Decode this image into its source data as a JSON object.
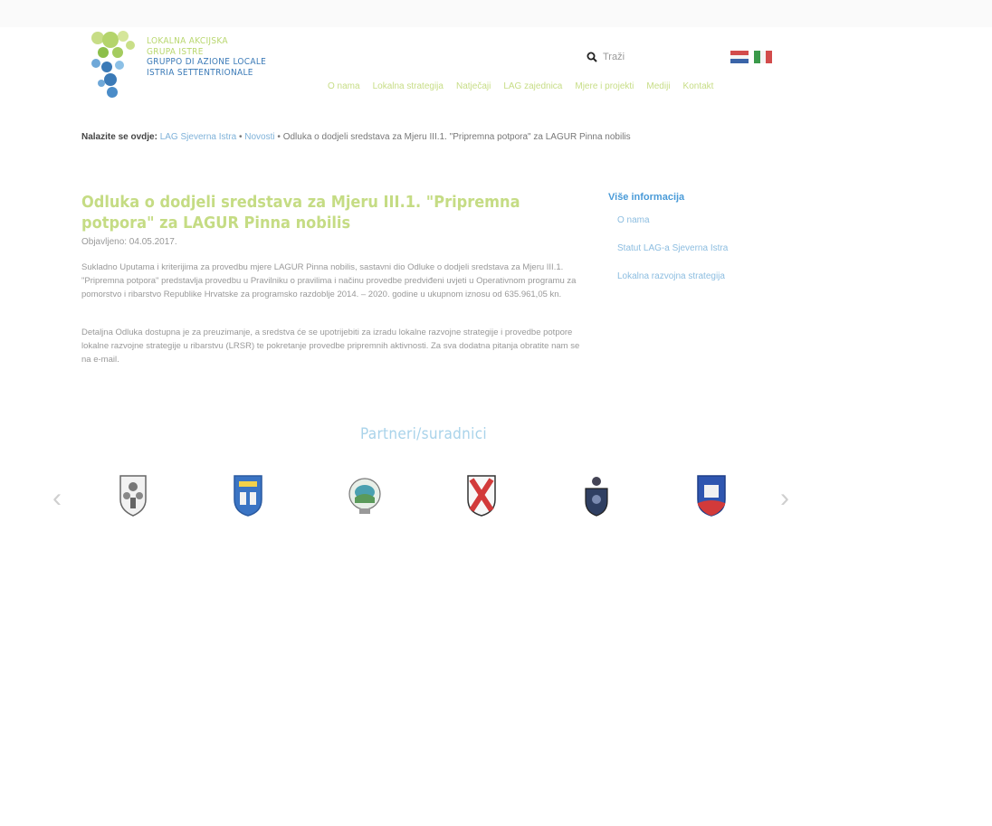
{
  "logo": {
    "line1": "LOKALNA AKCIJSKA",
    "line2": "GRUPA ISTRE",
    "line3": "GRUPPO DI AZIONE LOCALE",
    "line4": "ISTRIA SETTENTRIONALE"
  },
  "header": {
    "search_label": "Traži",
    "flags": [
      "hr-flag",
      "it-flag"
    ]
  },
  "nav": {
    "items": [
      "O nama",
      "Lokalna strategija",
      "Natječaji",
      "LAG zajednica",
      "Mjere i projekti",
      "Mediji",
      "Kontakt"
    ]
  },
  "breadcrumb": {
    "label": "Nalazite se ovdje:",
    "home": "LAG Sjeverna Istra",
    "section": "Novosti",
    "current": "Odluka o dodjeli sredstava za Mjeru III.1. \"Pripremna potpora\" za LAGUR Pinna nobilis"
  },
  "article": {
    "title": "Odluka o dodjeli sredstava za Mjeru III.1. \"Pripremna potpora\" za LAGUR Pinna nobilis",
    "published": "Objavljeno: 04.05.2017.",
    "paragraph1": "Sukladno Uputama i kriterijima za provedbu mjere LAGUR Pinna nobilis, sastavni dio Odluke o dodjeli sredstava za Mjeru III.1. \"Pripremna potpora\" predstavlja provedbu u Pravilniku o pravilima i načinu provedbe predviđeni uvjeti u Operativnom programu za pomorstvo i ribarstvo Republike Hrvatske za programsko razdoblje 2014. – 2020. godine u ukupnom iznosu od 635.961,05 kn.",
    "paragraph2": "Detaljna Odluka dostupna je za preuzimanje, a sredstva će se upotrijebiti za izradu lokalne razvojne strategije i provedbe potpore lokalne razvojne strategije u ribarstvu (LRSR) te pokretanje provedbe pripremnih aktivnosti. Za sva dodatna pitanja obratite nam se na e-mail."
  },
  "sidebar": {
    "title": "Više informacija",
    "links": [
      "O nama",
      "Statut LAG-a Sjeverna Istra",
      "Lokalna razvojna strategija"
    ]
  },
  "partners": {
    "title": "Partneri/suradnici",
    "logos": [
      "city-crest-1",
      "city-crest-2",
      "city-crest-3",
      "city-crest-4",
      "city-crest-5",
      "city-crest-6"
    ],
    "prev": "‹",
    "next": "›"
  }
}
